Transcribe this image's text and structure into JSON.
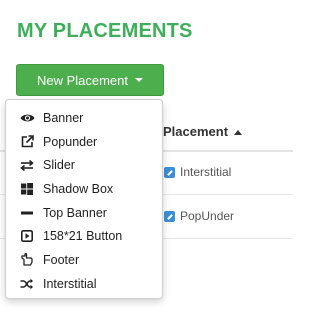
{
  "page": {
    "title": "MY PLACEMENTS"
  },
  "toolbar": {
    "new_placement_label": "New Placement"
  },
  "dropdown": {
    "items": [
      {
        "label": "Banner",
        "icon": "eye-icon"
      },
      {
        "label": "Popunder",
        "icon": "external-link-icon"
      },
      {
        "label": "Slider",
        "icon": "exchange-arrows-icon"
      },
      {
        "label": "Shadow Box",
        "icon": "windows-grid-icon"
      },
      {
        "label": "Top Banner",
        "icon": "minus-bar-icon"
      },
      {
        "label": "158*21 Button",
        "icon": "play-square-icon"
      },
      {
        "label": "Footer",
        "icon": "hand-pointing-icon"
      },
      {
        "label": "Interstitial",
        "icon": "shuffle-icon"
      }
    ]
  },
  "table": {
    "columns": {
      "placement": "Placement"
    },
    "rows": [
      {
        "placement": "Interstitial"
      },
      {
        "placement": "PopUnder"
      }
    ]
  },
  "colors": {
    "accent_green": "#3fae5a",
    "button_green": "#4cae4c",
    "edit_icon_blue": "#3a8fd8"
  }
}
